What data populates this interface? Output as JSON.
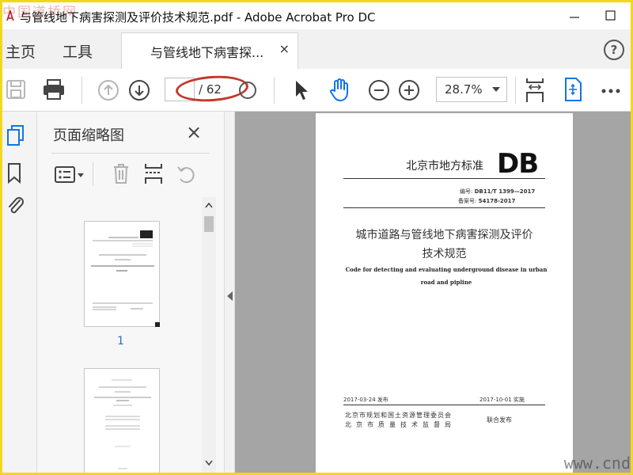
{
  "window": {
    "title": "与管线地下病害探测及评价技术规范.pdf - Adobe Acrobat Pro DC",
    "watermark_top": "中国道桥网"
  },
  "tabs": {
    "home": "主页",
    "tools": "工具",
    "document": "与管线地下病害探...",
    "close": "×",
    "help": "?"
  },
  "toolbar": {
    "page_current": "",
    "page_total": "/ 62",
    "zoom": "28.7%",
    "accent": "#1473e6",
    "highlight_color": "#c0392b"
  },
  "thumbnail_panel": {
    "title": "页面缩略图",
    "close": "×",
    "pages": [
      {
        "number": "1"
      },
      {
        "number": ""
      }
    ]
  },
  "document": {
    "org": "北京市地方标准",
    "logo": "DB",
    "code_label": "编号:",
    "code_value": "DB11/T 1399—2017",
    "record_label": "备案号:",
    "record_value": "54178-2017",
    "title_cn_line1": "城市道路与管线地下病害探测及评价",
    "title_cn_line2": "技术规范",
    "title_en": "Code for detecting and evaluating underground disease in urban road and pipline",
    "publish_date": "2017-03-24 发布",
    "implement_date": "2017-10-01 实施",
    "issuer_line1": "北京市规划和国土资源管理委员会",
    "issuer_line2": "北京市质量技术监督局",
    "joint": "联合发布"
  },
  "watermark_bottom": "www.cnd"
}
